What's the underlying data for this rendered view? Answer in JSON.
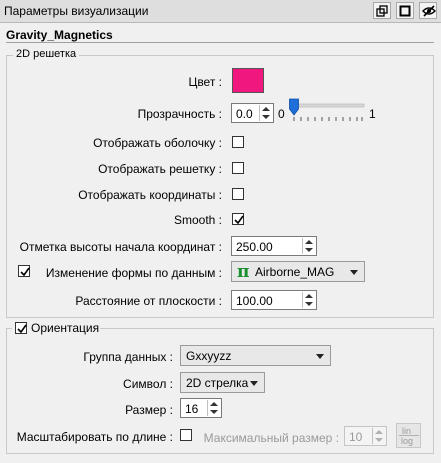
{
  "panel": {
    "title": "Параметры визуализации"
  },
  "object_name": "Gravity_Magnetics",
  "grid2d": {
    "group_label": "2D решетка",
    "color_label": "Цвет :",
    "color_value": "#f0177e",
    "transparency_label": "Прозрачность :",
    "transparency_value": "0.0",
    "slider_min": "0",
    "slider_max": "1",
    "slider_level": 0.0,
    "show_shell_label": "Отображать оболочку :",
    "show_shell_checked": false,
    "show_grid_label": "Отображать решетку :",
    "show_grid_checked": false,
    "show_coords_label": "Отображать координаты :",
    "show_coords_checked": false,
    "smooth_label": "Smooth :",
    "smooth_checked": true,
    "height_mark_label": "Отметка высоты начала координат :",
    "height_mark_value": "250.00",
    "shape_change_checked": true,
    "shape_change_label": "Изменение формы по данным :",
    "shape_change_value": "Airborne_MAG",
    "shape_change_icon": "pi-icon",
    "distance_label": "Расстояние от плоскости :",
    "distance_value": "100.00"
  },
  "orientation": {
    "checked": true,
    "group_label": "Ориентация",
    "data_group_label": "Группа данных :",
    "data_group_value": "Gxxyyzz",
    "symbol_label": "Символ :",
    "symbol_value": "2D стрелка",
    "size_label": "Размер :",
    "size_value": "16",
    "scale_by_length_label": "Масштабировать по длине :",
    "scale_by_length_checked": false,
    "max_size_label": "Максимальный размер :",
    "max_size_value": "10",
    "linlog_top": "lin",
    "linlog_bottom": "log"
  }
}
